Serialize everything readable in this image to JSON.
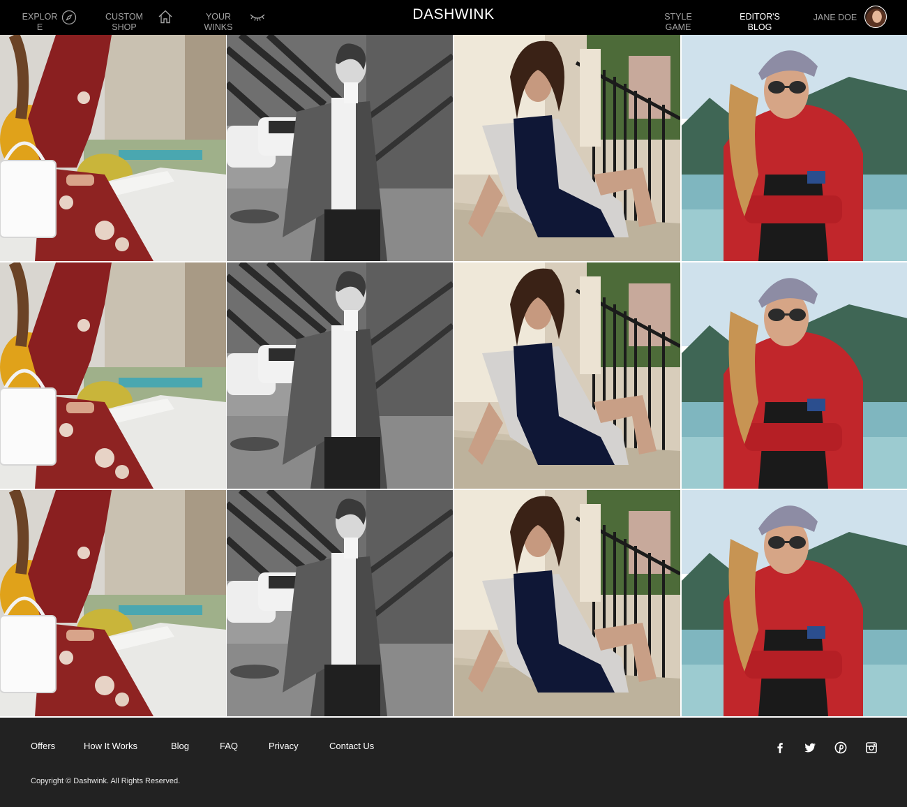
{
  "nav": {
    "explore": {
      "label": "EXPLORE",
      "icon": "compass-icon"
    },
    "custom_shop": {
      "label": "CUSTOM SHOP",
      "icon": "home-icon"
    },
    "your_winks": {
      "label": "YOUR WINKS",
      "icon": "eye-wink-icon"
    },
    "brand": "DASHWINK",
    "style_game": {
      "label": "STYLE GAME"
    },
    "editors_blog": {
      "label": "EDITOR'S BLOG",
      "active": true
    },
    "user": {
      "name": "JANE DOE",
      "avatar": "avatar-photo"
    }
  },
  "colors": {
    "topbar_bg": "#000000",
    "footer_bg": "#222222",
    "nav_text": "#a3a3a3",
    "nav_active": "#ffffff"
  },
  "grid": {
    "columns": 4,
    "rows": 3,
    "photos": [
      "woman in red floral off-shoulder dress with white handbag",
      "black and white photo of woman in tweed blazer and turtleneck",
      "woman in grey cardigan and navy velvet slip dress on steps",
      "woman in red jacket with cap and sunglasses by a lake"
    ]
  },
  "footer": {
    "links": [
      "Offers",
      "How It Works",
      "Blog",
      "FAQ",
      "Privacy",
      "Contact Us"
    ],
    "social": [
      "facebook-icon",
      "twitter-icon",
      "pinterest-icon",
      "instagram-icon"
    ],
    "copyright": "Copyright © Dashwink. All Rights Reserved."
  }
}
